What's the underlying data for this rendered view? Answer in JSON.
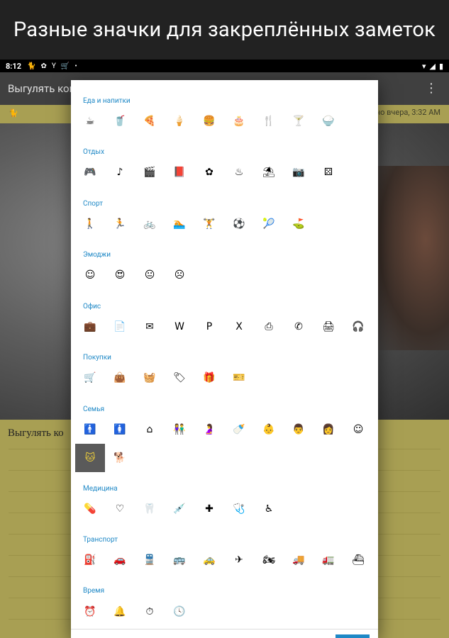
{
  "banner": {
    "title": "Разные значки для закреплённых заметок"
  },
  "status": {
    "time": "8:12",
    "icons_left": [
      "cat-icon",
      "flower-icon",
      "cocktail-icon",
      "cart-icon",
      "dot-icon"
    ],
    "icons_right": [
      "wifi-icon",
      "signal-icon",
      "battery-icon"
    ]
  },
  "appbar": {
    "title": "Выгулять кошк",
    "menu": "⋮"
  },
  "note": {
    "date": "но вчера, 3:32 AM",
    "title": "Выгулять ко",
    "badge": "🐱"
  },
  "dialog": {
    "sections": [
      {
        "label": "Еда и напитки",
        "icons": [
          {
            "name": "coffee-icon",
            "glyph": "☕"
          },
          {
            "name": "drink-cup-icon",
            "glyph": "🥤"
          },
          {
            "name": "pizza-icon",
            "glyph": "🍕"
          },
          {
            "name": "ice-cream-icon",
            "glyph": "🍦"
          },
          {
            "name": "fast-food-icon",
            "glyph": "🍔"
          },
          {
            "name": "cake-icon",
            "glyph": "🎂"
          },
          {
            "name": "restaurant-icon",
            "glyph": "🍴"
          },
          {
            "name": "cocktail-icon",
            "glyph": "🍸"
          },
          {
            "name": "rice-bowl-icon",
            "glyph": "🍚"
          }
        ]
      },
      {
        "label": "Отдых",
        "icons": [
          {
            "name": "gamepad-icon",
            "glyph": "🎮"
          },
          {
            "name": "music-note-icon",
            "glyph": "♪"
          },
          {
            "name": "movie-icon",
            "glyph": "🎬"
          },
          {
            "name": "book-icon",
            "glyph": "📕"
          },
          {
            "name": "flower-icon",
            "glyph": "✿"
          },
          {
            "name": "hot-tub-icon",
            "glyph": "♨"
          },
          {
            "name": "beach-icon",
            "glyph": "⛱"
          },
          {
            "name": "camera-icon",
            "glyph": "📷"
          },
          {
            "name": "dice-icon",
            "glyph": "⚄"
          }
        ]
      },
      {
        "label": "Спорт",
        "icons": [
          {
            "name": "hiking-icon",
            "glyph": "🚶"
          },
          {
            "name": "running-icon",
            "glyph": "🏃"
          },
          {
            "name": "bike-icon",
            "glyph": "🚲"
          },
          {
            "name": "swimming-icon",
            "glyph": "🏊"
          },
          {
            "name": "fitness-icon",
            "glyph": "🏋"
          },
          {
            "name": "soccer-icon",
            "glyph": "⚽"
          },
          {
            "name": "tennis-icon",
            "glyph": "🎾"
          },
          {
            "name": "golf-icon",
            "glyph": "⛳"
          }
        ]
      },
      {
        "label": "Эмоджи",
        "icons": [
          {
            "name": "smile-icon",
            "glyph": "☺"
          },
          {
            "name": "love-face-icon",
            "glyph": "😍"
          },
          {
            "name": "neutral-face-icon",
            "glyph": "😐"
          },
          {
            "name": "sad-face-icon",
            "glyph": "☹"
          }
        ]
      },
      {
        "label": "Офис",
        "icons": [
          {
            "name": "briefcase-icon",
            "glyph": "💼"
          },
          {
            "name": "document-icon",
            "glyph": "📄"
          },
          {
            "name": "email-icon",
            "glyph": "✉"
          },
          {
            "name": "word-icon",
            "glyph": "W"
          },
          {
            "name": "powerpoint-icon",
            "glyph": "P"
          },
          {
            "name": "excel-icon",
            "glyph": "X"
          },
          {
            "name": "pdf-icon",
            "glyph": "⎙"
          },
          {
            "name": "phone-icon",
            "glyph": "✆"
          },
          {
            "name": "printer-icon",
            "glyph": "🖨"
          },
          {
            "name": "headset-icon",
            "glyph": "🎧"
          }
        ]
      },
      {
        "label": "Покупки",
        "icons": [
          {
            "name": "cart-icon",
            "glyph": "🛒"
          },
          {
            "name": "shopping-bag-icon",
            "glyph": "👜"
          },
          {
            "name": "basket-icon",
            "glyph": "🧺"
          },
          {
            "name": "tag-icon",
            "glyph": "🏷"
          },
          {
            "name": "gift-icon",
            "glyph": "🎁"
          },
          {
            "name": "gift-card-icon",
            "glyph": "🎫"
          }
        ]
      },
      {
        "label": "Семья",
        "icons": [
          {
            "name": "man-icon",
            "glyph": "🚹"
          },
          {
            "name": "woman-icon",
            "glyph": "🚺"
          },
          {
            "name": "home-heart-icon",
            "glyph": "⌂"
          },
          {
            "name": "couple-icon",
            "glyph": "👫"
          },
          {
            "name": "pregnant-icon",
            "glyph": "🤰"
          },
          {
            "name": "stroller-icon",
            "glyph": "🍼"
          },
          {
            "name": "baby-crawl-icon",
            "glyph": "👶"
          },
          {
            "name": "father-child-icon",
            "glyph": "👨"
          },
          {
            "name": "mother-child-icon",
            "glyph": "👩"
          },
          {
            "name": "child-face-icon",
            "glyph": "☺"
          },
          {
            "name": "cat-icon",
            "glyph": "🐱",
            "selected": true
          },
          {
            "name": "dog-icon",
            "glyph": "🐕"
          }
        ]
      },
      {
        "label": "Медицина",
        "icons": [
          {
            "name": "pill-icon",
            "glyph": "💊"
          },
          {
            "name": "heartbeat-icon",
            "glyph": "♡"
          },
          {
            "name": "tooth-icon",
            "glyph": "🦷"
          },
          {
            "name": "syringe-icon",
            "glyph": "💉"
          },
          {
            "name": "first-aid-icon",
            "glyph": "✚"
          },
          {
            "name": "stethoscope-icon",
            "glyph": "🩺"
          },
          {
            "name": "wheelchair-icon",
            "glyph": "♿"
          }
        ]
      },
      {
        "label": "Транспорт",
        "icons": [
          {
            "name": "gas-station-icon",
            "glyph": "⛽"
          },
          {
            "name": "car-icon",
            "glyph": "🚗"
          },
          {
            "name": "train-icon",
            "glyph": "🚆"
          },
          {
            "name": "bus-icon",
            "glyph": "🚌"
          },
          {
            "name": "taxi-icon",
            "glyph": "🚕"
          },
          {
            "name": "flight-icon",
            "glyph": "✈"
          },
          {
            "name": "motorcycle-icon",
            "glyph": "🏍"
          },
          {
            "name": "truck-icon",
            "glyph": "🚚"
          },
          {
            "name": "tow-truck-icon",
            "glyph": "🚛"
          },
          {
            "name": "ferry-icon",
            "glyph": "⛴"
          }
        ]
      },
      {
        "label": "Время",
        "icons": [
          {
            "name": "alarm-icon",
            "glyph": "⏰"
          },
          {
            "name": "bell-icon",
            "glyph": "🔔"
          },
          {
            "name": "timer-icon",
            "glyph": "⏱"
          },
          {
            "name": "clock-icon",
            "glyph": "🕓"
          }
        ]
      }
    ]
  },
  "colors": {
    "accent": "#1e88c6",
    "note_bg": "#a89f53",
    "selected_bg": "#5a5a5a",
    "selected_fg": "#f4d33a"
  }
}
